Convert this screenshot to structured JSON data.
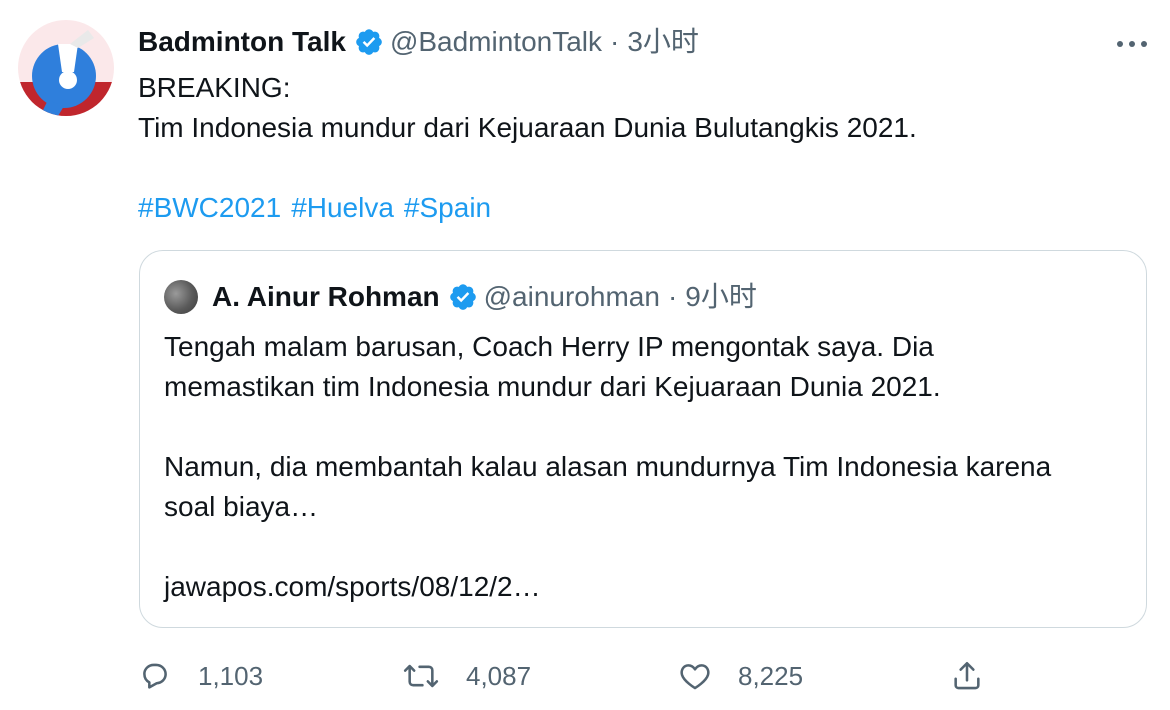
{
  "tweet": {
    "author_name": "Badminton Talk",
    "author_handle": "@BadmintonTalk",
    "separator": "·",
    "time": "3小时",
    "text_lines": [
      "BREAKING:",
      "Tim Indonesia mundur dari Kejuaraan Dunia Bulutangkis 2021."
    ],
    "hashtags": [
      "#BWC2021",
      "#Huelva",
      "#Spain"
    ]
  },
  "quote": {
    "author_name": "A. Ainur Rohman",
    "author_handle": "@ainurohman",
    "separator": "·",
    "time": "9小时",
    "paragraph1_lines": [
      "Tengah malam barusan, Coach Herry IP mengontak saya. Dia",
      "memastikan tim Indonesia mundur dari Kejuaraan Dunia 2021."
    ],
    "paragraph2_lines": [
      "Namun, dia membantah kalau alasan mundurnya Tim Indonesia karena",
      "soal biaya…"
    ],
    "link": "jawapos.com/sports/08/12/2…"
  },
  "actions": {
    "replies": "1,103",
    "retweets": "4,087",
    "likes": "8,225"
  },
  "icons": {
    "verified": "verified-badge-icon",
    "more": "more-icon",
    "reply": "reply-icon",
    "retweet": "retweet-icon",
    "like": "heart-icon",
    "share": "share-icon"
  },
  "colors": {
    "link_blue": "#1d9bf0",
    "muted_gray": "#536471",
    "border": "#cfd9de",
    "avatar_blue": "#2f7fdc",
    "avatar_red": "#c0262d"
  }
}
